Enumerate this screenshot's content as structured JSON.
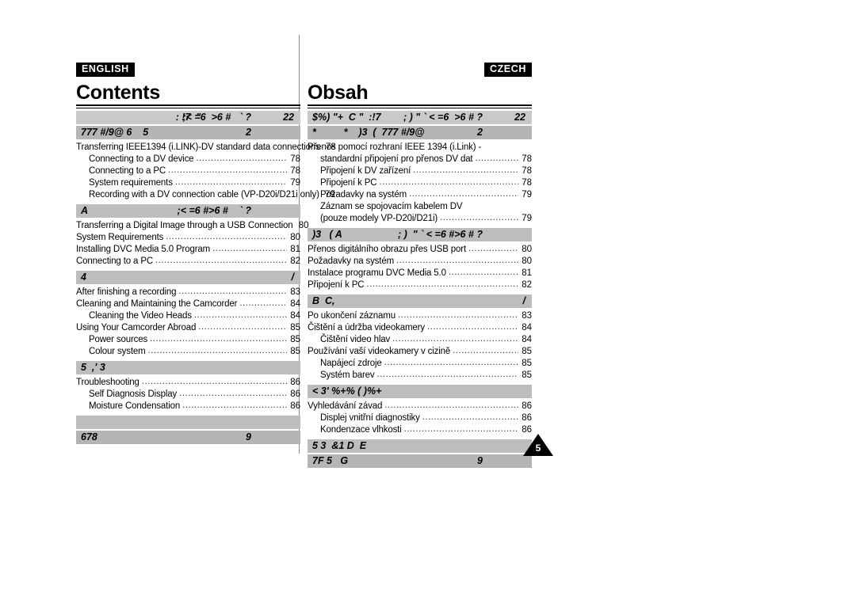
{
  "document": {
    "title_en": "Contents",
    "title_cz": "Obsah",
    "page_number": "5"
  },
  "badges": {
    "english": "ENGLISH",
    "czech": "CZECH"
  },
  "english": {
    "header_bar_1": {
      "center": ": !7  \"",
      "mid": ";< =6  >6 #   ` ?",
      "right": "22"
    },
    "header_bar_2": {
      "left": "777 #/9@ 6    5",
      "right": "2"
    },
    "sections": [
      {
        "bar": {
          "left": "",
          "center": "",
          "right": ""
        },
        "entries": [
          {
            "text": "Transferring IEEE1394 (i.LINK)-DV standard data connections",
            "page": "78",
            "indent": 0
          },
          {
            "text": "Connecting to a DV device",
            "page": "78",
            "indent": 1
          },
          {
            "text": "Connecting to a PC",
            "page": "78",
            "indent": 1
          },
          {
            "text": "System requirements",
            "page": "79",
            "indent": 1
          },
          {
            "text": "Recording with a DV connection cable (VP-D20i/D21i only)",
            "page": "79",
            "indent": 1
          }
        ]
      },
      {
        "bar": {
          "left": "A",
          "center": ";< =6 #>6 #    ` ?",
          "right": ""
        },
        "entries": [
          {
            "text": "Transferring a Digital Image through a USB Connection",
            "page": "80",
            "indent": 0
          },
          {
            "text": "System Requirements",
            "page": "80",
            "indent": 0
          },
          {
            "text": "Installing DVC Media 5.0 Program",
            "page": "81",
            "indent": 0
          },
          {
            "text": "Connecting to a PC",
            "page": "82",
            "indent": 0
          }
        ]
      },
      {
        "bar": {
          "left": "4",
          "center": "",
          "right": "/"
        },
        "entries": [
          {
            "text": "After finishing a recording",
            "page": "83",
            "indent": 0
          },
          {
            "text": "Cleaning and Maintaining the Camcorder",
            "page": "84",
            "indent": 0
          },
          {
            "text": "Cleaning the Video Heads",
            "page": "84",
            "indent": 1
          },
          {
            "text": "Using Your Camcorder Abroad",
            "page": "85",
            "indent": 0
          },
          {
            "text": "Power sources",
            "page": "85",
            "indent": 1
          },
          {
            "text": "Colour system",
            "page": "85",
            "indent": 1
          }
        ]
      },
      {
        "bar": {
          "left": "5  ,' 3",
          "center": "",
          "right": ""
        },
        "entries": [
          {
            "text": "Troubleshooting",
            "page": "86",
            "indent": 0
          },
          {
            "text": "Self Diagnosis Display",
            "page": "86",
            "indent": 1
          },
          {
            "text": "Moisture Condensation",
            "page": "86",
            "indent": 1
          }
        ]
      }
    ],
    "footer_bar_1": {
      "left": "",
      "right": ""
    },
    "footer_bar_2": {
      "left": "678",
      "right": "9"
    }
  },
  "czech": {
    "header_bar_1": {
      "left": "$%) \"+  C \"  :!7",
      "mid": "; ) \" ` < =6  >6 # ?",
      "right": "22"
    },
    "header_bar_2": {
      "left": "*          *    )3  (  777 #/9@",
      "right": "2"
    },
    "sections": [
      {
        "bar": {
          "left": "",
          "center": "",
          "right": ""
        },
        "entries": [
          {
            "text": "Přenos pomocí rozhraní IEEE 1394 (i.Link) -",
            "page": "",
            "indent": 0,
            "nodots": true
          },
          {
            "text": "standardní připojení pro přenos DV dat",
            "page": "78",
            "indent": 1
          },
          {
            "text": "Připojení k DV zařízení",
            "page": "78",
            "indent": 1
          },
          {
            "text": "Připojení k PC",
            "page": "78",
            "indent": 1
          },
          {
            "text": "Požadavky na systém",
            "page": "79",
            "indent": 1
          },
          {
            "text": "Záznam se spojovacím kabelem DV",
            "page": "",
            "indent": 1,
            "nodots": true
          },
          {
            "text": "(pouze modely VP-D20i/D21i)",
            "page": "79",
            "indent": 1
          }
        ]
      },
      {
        "bar": {
          "left": ")3   ( A",
          "center": "; )  \" ` < =6 #>6 # ?",
          "right": ""
        },
        "entries": [
          {
            "text": "Přenos digitálního obrazu přes USB port",
            "page": "80",
            "indent": 0
          },
          {
            "text": "Požadavky na systém",
            "page": "80",
            "indent": 0
          },
          {
            "text": "Instalace programu DVC Media 5.0",
            "page": "81",
            "indent": 0
          },
          {
            "text": "Připojení k PC",
            "page": "82",
            "indent": 0
          }
        ]
      },
      {
        "bar": {
          "left": "B  C,",
          "center": "",
          "right": "/"
        },
        "entries": [
          {
            "text": "Po ukončení záznamu",
            "page": "83",
            "indent": 0
          },
          {
            "text": "Čištění a údržba videokamery",
            "page": "84",
            "indent": 0
          },
          {
            "text": "Čištění video hlav",
            "page": "84",
            "indent": 1
          },
          {
            "text": "Používání vaší videokamery v cizině",
            "page": "85",
            "indent": 0
          },
          {
            "text": "Napájecí zdroje",
            "page": "85",
            "indent": 1
          },
          {
            "text": "Systém barev",
            "page": "85",
            "indent": 1
          }
        ]
      },
      {
        "bar": {
          "left": "< 3' %+% ( )%+",
          "center": "",
          "right": ""
        },
        "entries": [
          {
            "text": "Vyhledávání závad",
            "page": "86",
            "indent": 0
          },
          {
            "text": "Displej vnitřní diagnostiky",
            "page": "86",
            "indent": 1
          },
          {
            "text": "Kondenzace vlhkosti",
            "page": "86",
            "indent": 1
          }
        ]
      }
    ],
    "footer_bar_1": {
      "left": "5 3  &1 D  E",
      "right": ""
    },
    "footer_bar_2": {
      "left": "7F 5   G",
      "right": "9"
    }
  }
}
